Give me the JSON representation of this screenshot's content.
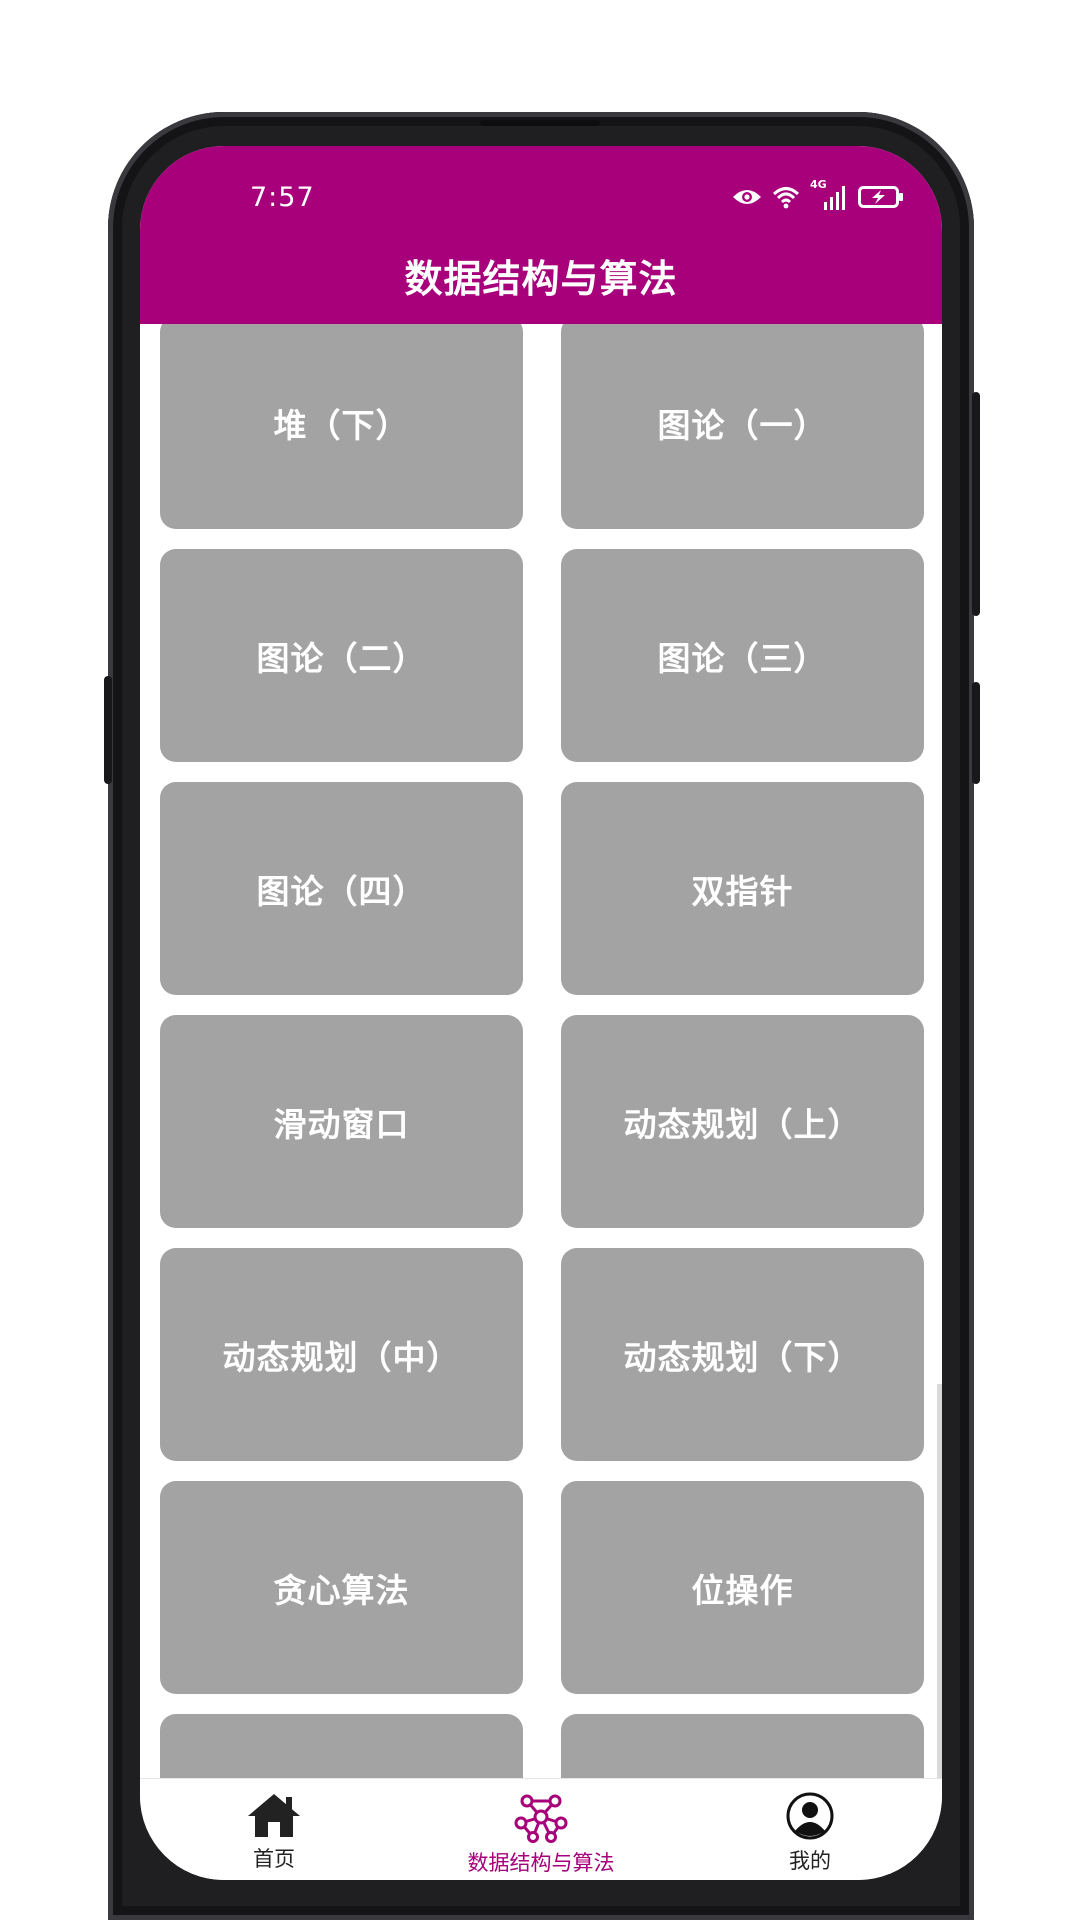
{
  "status_bar": {
    "time": "7:57",
    "network_label": "4G",
    "icons": [
      "eye-icon",
      "wifi-icon",
      "signal-icon",
      "battery-charging-icon"
    ]
  },
  "app_bar": {
    "title": "数据结构与算法"
  },
  "topics": [
    {
      "label": "堆（下）"
    },
    {
      "label": "图论（一）"
    },
    {
      "label": "图论（二）"
    },
    {
      "label": "图论（三）"
    },
    {
      "label": "图论（四）"
    },
    {
      "label": "双指针"
    },
    {
      "label": "滑动窗口"
    },
    {
      "label": "动态规划（上）"
    },
    {
      "label": "动态规划（中）"
    },
    {
      "label": "动态规划（下）"
    },
    {
      "label": "贪心算法"
    },
    {
      "label": "位操作"
    },
    {
      "label": ""
    },
    {
      "label": ""
    }
  ],
  "bottom_nav": {
    "items": [
      {
        "label": "首页",
        "icon": "home-icon",
        "active": false
      },
      {
        "label": "数据结构与算法",
        "icon": "network-icon",
        "active": true
      },
      {
        "label": "我的",
        "icon": "user-icon",
        "active": false
      }
    ]
  },
  "colors": {
    "accent": "#a7007a",
    "card": "#a3a3a3",
    "card_text": "#ffffff"
  }
}
